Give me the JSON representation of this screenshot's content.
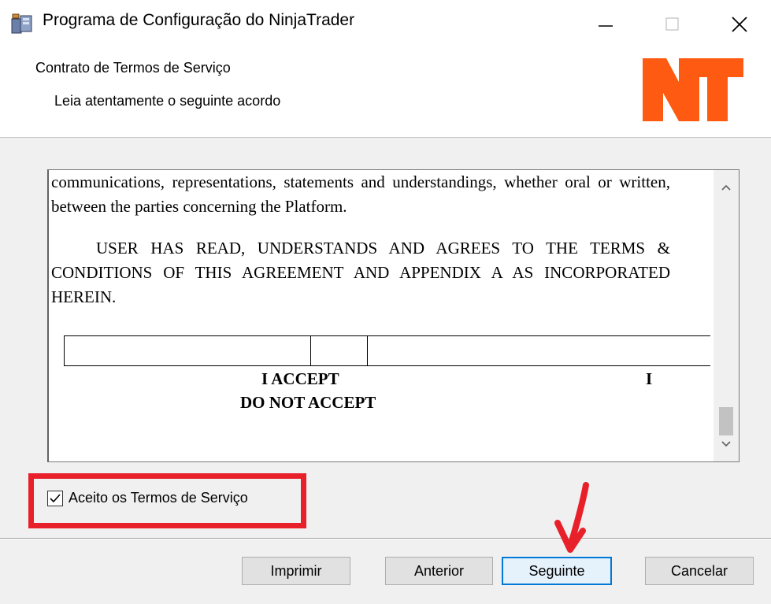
{
  "window": {
    "title": "Programa de Configuração do NinjaTrader",
    "icon": "installer-icon",
    "controls": [
      "minimize-icon",
      "maximize-icon",
      "close-icon"
    ]
  },
  "header": {
    "title": "Contrato de Termos de Serviço",
    "subtitle": "Leia atentamente o seguinte acordo",
    "logo": "NT"
  },
  "agreement": {
    "paragraph1": "communications, representations, statements and understandings, whether oral or written, between the parties concerning the Platform.",
    "paragraph2": "USER HAS READ, UNDERSTANDS AND AGREES TO THE TERMS & CONDITIONS OF THIS AGREEMENT AND APPENDIX A AS INCORPORATED HEREIN.",
    "accept_label": "I ACCEPT",
    "accept_marker": "I",
    "not_accept_label": "DO NOT ACCEPT"
  },
  "accept_checkbox": {
    "label": "Aceito os Termos de Serviço",
    "checked": true
  },
  "buttons": {
    "print": "Imprimir",
    "back": "Anterior",
    "next": "Seguinte",
    "cancel": "Cancelar"
  },
  "colors": {
    "brand_orange": "#ff5a12",
    "highlight_red": "#e8202a",
    "focus_blue": "#0078d7"
  }
}
